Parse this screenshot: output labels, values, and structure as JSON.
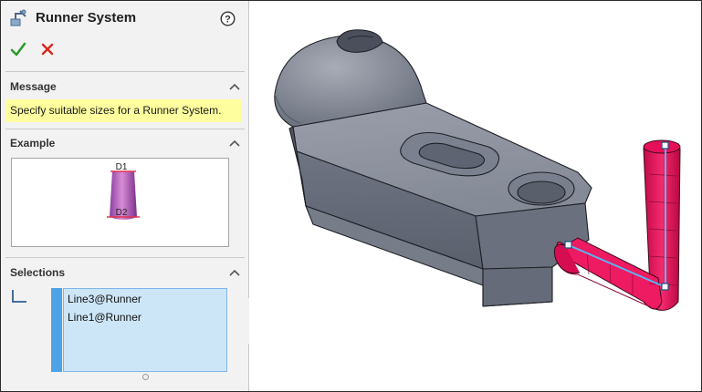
{
  "header": {
    "title": "Runner System"
  },
  "icons": {
    "feature": "runner-system-icon",
    "help": "help-icon",
    "ok": "checkmark-icon",
    "cancel": "close-icon",
    "collapse": "chevron-up-icon",
    "selection": "line-selection-icon"
  },
  "sections": {
    "message": {
      "title": "Message",
      "text": "Specify suitable sizes for a Runner System."
    },
    "example": {
      "title": "Example",
      "top_label": "D1",
      "bottom_label": "D2"
    },
    "selections": {
      "title": "Selections",
      "items": [
        "Line3@Runner",
        "Line1@Runner"
      ]
    }
  },
  "colors": {
    "message_highlight": "#fefe9f",
    "selection_fill": "#cde6f7",
    "selection_accent": "#4da3e8",
    "ok_green": "#2e9a2e",
    "cancel_red": "#d9261c",
    "runner_pink": "#f0105c",
    "part_gray": "#7d8290"
  }
}
